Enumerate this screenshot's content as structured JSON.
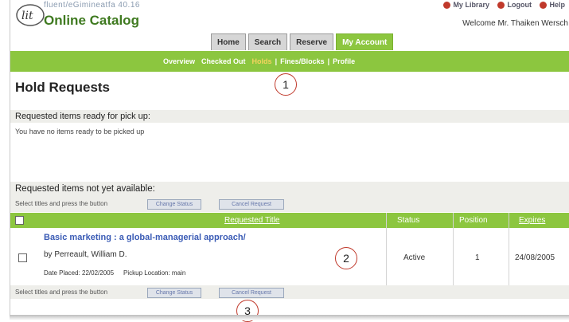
{
  "header": {
    "url_text": "fluent/eGimineatfa 40.16",
    "app_title": "Online Catalog",
    "top_links": [
      "My Library",
      "Logout",
      "Help"
    ],
    "welcome": "Welcome Mr. Thaiken Wersch"
  },
  "tabs": [
    {
      "label": "Home"
    },
    {
      "label": "Search"
    },
    {
      "label": "Reserve"
    },
    {
      "label": "My Account"
    }
  ],
  "subnav": [
    {
      "label": "Overview"
    },
    {
      "label": "Checked Out"
    },
    {
      "label": "Holds"
    },
    {
      "label": "Fines/Blocks"
    },
    {
      "label": "Profile"
    }
  ],
  "page_title": "Hold Requests",
  "ready": {
    "heading": "Requested items ready for pick up:",
    "message": "You have no items ready to be picked up"
  },
  "not_ready": {
    "heading": "Requested items not yet available:",
    "instruction": "Select titles and press the button",
    "change_status_label": "Change Status",
    "cancel_label": "Cancel Request"
  },
  "table": {
    "headers": {
      "title": "Requested Title",
      "status": "Status",
      "position": "Position",
      "expires": "Expires"
    },
    "rows": [
      {
        "title": "Basic marketing : a global-managerial approach/",
        "author": "by Perreault, William D.",
        "date_placed": "Date Placed: 22/02/2005",
        "pickup": "Pickup Location: main",
        "status": "Active",
        "position": "1",
        "expires": "24/08/2005"
      }
    ]
  },
  "footer_actions": {
    "instruction": "Select titles and press the button",
    "change_status_label": "Change Status",
    "cancel_label": "Cancel Request"
  },
  "callouts": [
    "1",
    "2",
    "3"
  ],
  "colors": {
    "accent_green": "#8cc63f",
    "link_blue": "#3a5bb5",
    "callout_red": "#c0392b"
  }
}
